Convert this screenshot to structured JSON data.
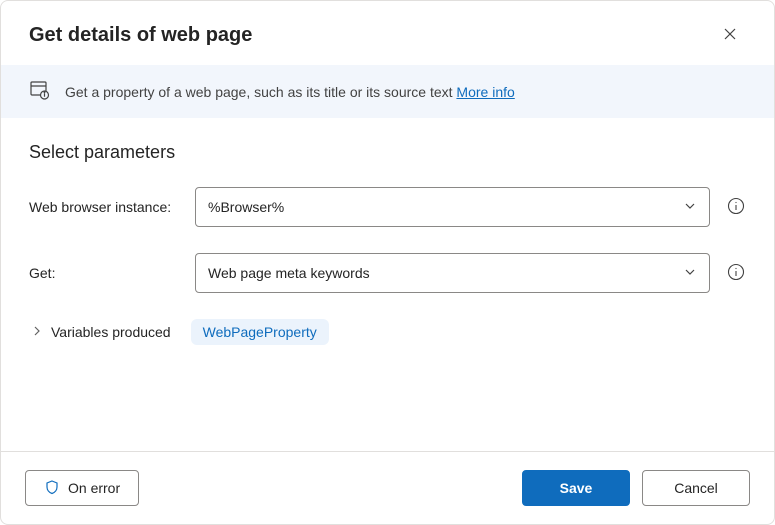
{
  "header": {
    "title": "Get details of web page"
  },
  "info": {
    "text": "Get a property of a web page, such as its title or its source text ",
    "link": "More info"
  },
  "section": {
    "title": "Select parameters"
  },
  "fields": {
    "browser": {
      "label": "Web browser instance:",
      "value": "%Browser%"
    },
    "get": {
      "label": "Get:",
      "value": "Web page meta keywords"
    }
  },
  "variables": {
    "label": "Variables produced",
    "chip": "WebPageProperty"
  },
  "footer": {
    "onError": "On error",
    "save": "Save",
    "cancel": "Cancel"
  }
}
